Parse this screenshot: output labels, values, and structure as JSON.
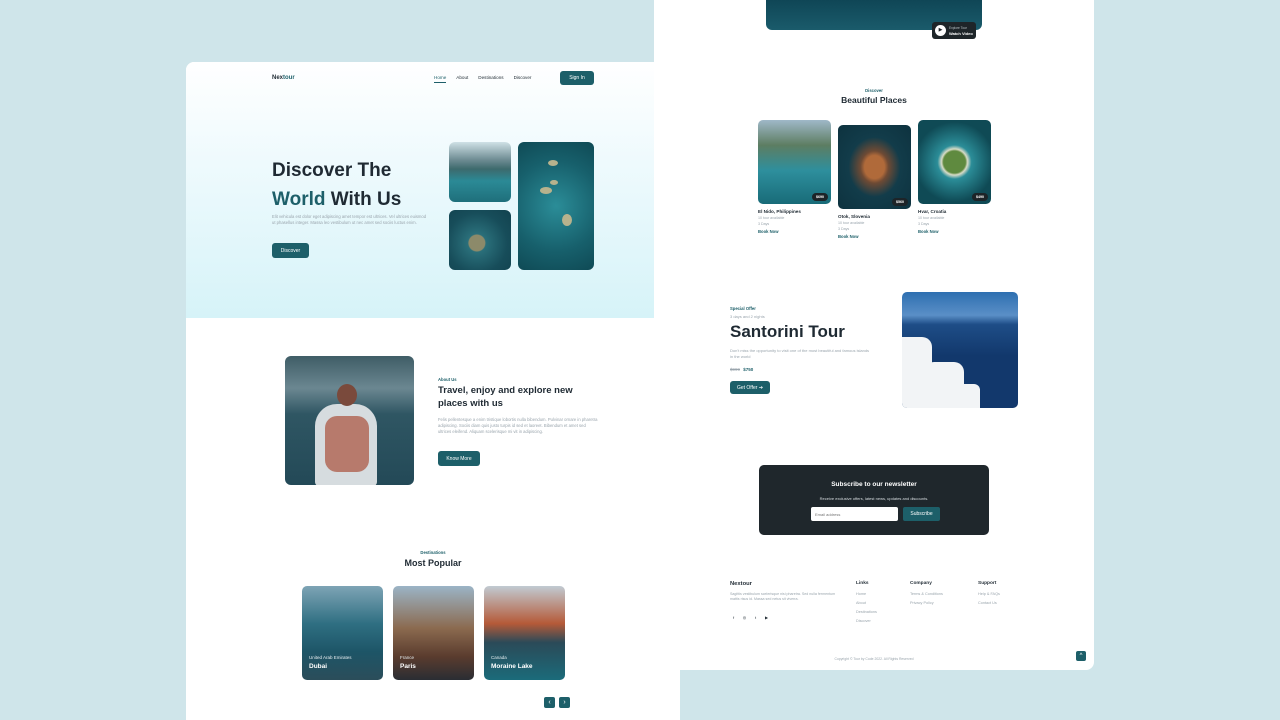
{
  "colors": {
    "accent": "#1d5f69",
    "dark": "#1f272c",
    "background": "#cfe5ea",
    "muted": "#9aa5ad"
  },
  "left": {
    "logo_a": "Nex",
    "logo_b": "tour",
    "nav": {
      "items": [
        "Home",
        "About",
        "Destinations",
        "Discover"
      ],
      "active": "Home",
      "signin": "Sign In"
    },
    "hero": {
      "title_line1": "Discover The",
      "title_accent": "World",
      "title_rest": " With Us",
      "description": "Elit vehicula est dolor eget adipiscing amet tempor est ultrices. Vel ultrices euismod ut phasellus integer. Massa leo vestibulum ut nec amet sed sociis luctus enim.",
      "button": "Discover"
    },
    "about": {
      "tag": "About Us",
      "title": "Travel, enjoy and explore new places with us",
      "description": "Felis pellentesque a enim tristique lobortis nulla bibendum. Pulvinar ornare in pharetra adipiscing. Sociis diam quis justo turpis id sed et laoreet. Bibendum et amet sed ultrices eleifend. Aliquam scelerisque mi vit in adipiscing.",
      "button": "Know More"
    },
    "destinations": {
      "tag": "Destinations",
      "title": "Most Popular",
      "cards": [
        {
          "country": "United Arab Emirates",
          "name": "Dubai"
        },
        {
          "country": "France",
          "name": "Paris"
        },
        {
          "country": "Canada",
          "name": "Moraine Lake"
        }
      ],
      "prev_icon": "‹",
      "next_icon": "›"
    }
  },
  "right": {
    "video": {
      "small": "Explore Tour",
      "label": "Watch Video",
      "play_icon": "▶"
    },
    "places": {
      "tag": "Discover",
      "title": "Beautiful Places",
      "items": [
        {
          "name": "El Nido, Philippines",
          "tours": "10 tour available",
          "days": "3 Days",
          "price": "$690",
          "book": "Book Now"
        },
        {
          "name": "Otok, Slovenia",
          "tours": "10 tour available",
          "days": "3 Days",
          "price": "$560",
          "book": "Book Now"
        },
        {
          "name": "Hvar, Croatia",
          "tours": "10 tour available",
          "days": "3 Days",
          "price": "$490",
          "book": "Book Now"
        }
      ]
    },
    "offer": {
      "tag": "Special Offer",
      "duration": "3 days and 2 nights",
      "title": "Santorini Tour",
      "description": "Don't miss the opportunity to visit one of the most beautiful and famous islands in the world",
      "old_price": "$999",
      "new_price": "$750",
      "button": "Get Offer",
      "button_icon": "➔"
    },
    "newsletter": {
      "title": "Subscribe to our newsletter",
      "subtitle": "Receive exclusive offers, latest news, updates and discounts.",
      "placeholder": "Email address",
      "button": "Subscribe"
    },
    "footer": {
      "brand": "Nextour",
      "description": "Sagittis vestibulum scelerisque nisi pharetra. Sed nulla fermentum mattis risus id. Massa sed netus sit viverra.",
      "social": [
        "f",
        "◎",
        "t",
        "▶"
      ],
      "links": {
        "title": "Links",
        "items": [
          "Home",
          "About",
          "Destinations",
          "Discover"
        ]
      },
      "company": {
        "title": "Company",
        "items": [
          "Terms & Conditions",
          "Privacy Policy"
        ]
      },
      "support": {
        "title": "Support",
        "items": [
          "Help & FAQs",
          "Contact Us"
        ]
      },
      "copyright": "Copyright © Tour by Code 2022. All Rights Reserved",
      "top_icon": "^"
    }
  }
}
